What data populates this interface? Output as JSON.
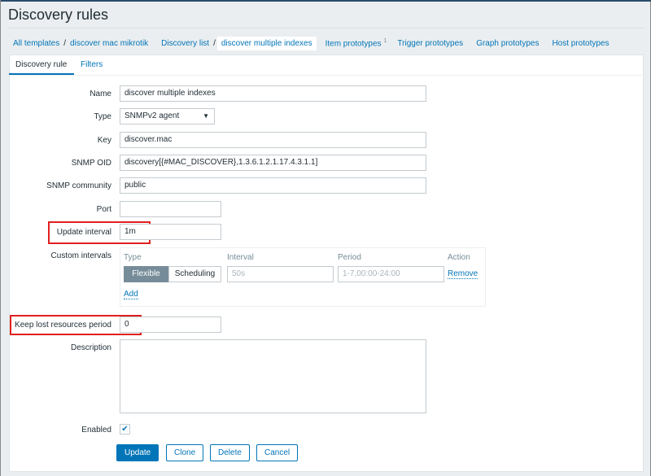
{
  "page": {
    "title": "Discovery rules"
  },
  "breadcrumb": {
    "all_templates": "All templates",
    "template": "discover mac mikrotik",
    "discovery_list": "Discovery list",
    "current": "discover multiple indexes",
    "item_prototypes": "Item prototypes",
    "item_prototypes_count": "1",
    "trigger_prototypes": "Trigger prototypes",
    "graph_prototypes": "Graph prototypes",
    "host_prototypes": "Host prototypes"
  },
  "tabs": [
    "Discovery rule",
    "Filters"
  ],
  "form": {
    "name": {
      "label": "Name",
      "value": "discover multiple indexes"
    },
    "type": {
      "label": "Type",
      "value": "SNMPv2 agent"
    },
    "key": {
      "label": "Key",
      "value": "discover.mac"
    },
    "snmp_oid": {
      "label": "SNMP OID",
      "value": "discovery[{#MAC_DISCOVER},1.3.6.1.2.1.17.4.3.1.1]"
    },
    "snmp_community": {
      "label": "SNMP community",
      "value": "public"
    },
    "port": {
      "label": "Port",
      "value": ""
    },
    "update_interval": {
      "label": "Update interval",
      "value": "1m"
    },
    "custom_intervals": {
      "label": "Custom intervals",
      "headers": [
        "Type",
        "Interval",
        "Period",
        "Action"
      ],
      "type_options": [
        "Flexible",
        "Scheduling"
      ],
      "selected_type": "Flexible",
      "interval_placeholder": "50s",
      "period_placeholder": "1-7,00:00-24:00",
      "remove": "Remove",
      "add": "Add"
    },
    "keep_lost": {
      "label": "Keep lost resources period",
      "value": "0"
    },
    "description": {
      "label": "Description",
      "value": ""
    },
    "enabled": {
      "label": "Enabled",
      "checked": true
    }
  },
  "buttons": {
    "update": "Update",
    "clone": "Clone",
    "delete": "Delete",
    "cancel": "Cancel"
  },
  "colors": {
    "accent": "#0275b8",
    "highlight": "#e02020"
  }
}
